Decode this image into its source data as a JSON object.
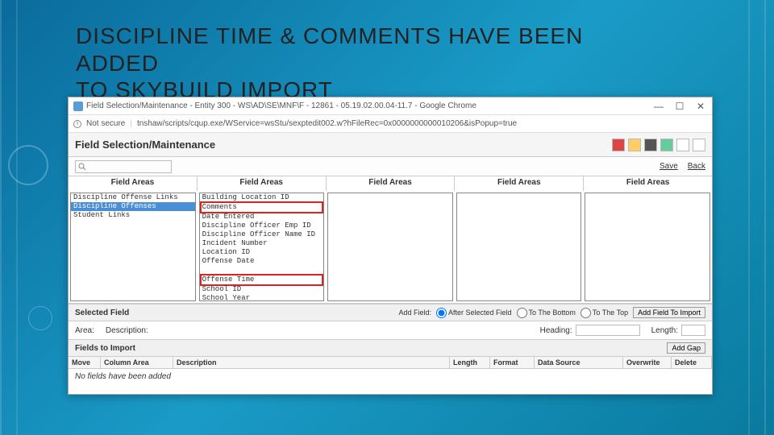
{
  "slide": {
    "title_l1": "DISCIPLINE TIME & COMMENTS HAVE BEEN",
    "title_l2": "ADDED",
    "title_l3": "TO SKYBUILD IMPORT"
  },
  "window": {
    "title": "Field Selection/Maintenance - Entity 300 - WS\\AD\\SE\\MNF\\F - 12861 - 05.19.02.00.04-11.7 - Google Chrome",
    "secure_label": "Not secure",
    "url": "tnshaw/scripts/cqup.exe/WService=wsStu/sexptedit002.w?hFileRec=0x0000000000010206&isPopup=true",
    "controls": {
      "min": "—",
      "max": "☐",
      "close": "✕"
    }
  },
  "app": {
    "title": "Field Selection/Maintenance",
    "save": "Save",
    "back": "Back",
    "col_header": "Field Areas",
    "col1_items": [
      "Discipline Offense Links",
      "Discipline Offenses",
      "Student Links"
    ],
    "col1_selected_index": 1,
    "col2_items": [
      "Building Location ID",
      "Comments",
      "Date Entered",
      "Discipline Officer Emp ID",
      "Discipline Officer Name ID",
      "Incident Number",
      "Location ID",
      "Offense Date",
      "",
      "Offense Time",
      "School ID",
      "School Year"
    ],
    "col2_highlight": [
      1,
      9
    ],
    "selected_field_label": "Selected Field",
    "add_field_label": "Add Field:",
    "radio_after": "After Selected Field",
    "radio_bottom": "To The Bottom",
    "radio_top": "To The Top",
    "add_btn": "Add Field To Import",
    "area_label": "Area:",
    "desc_label": "Description:",
    "heading_label": "Heading:",
    "length_label": "Length:",
    "fields_import_title": "Fields to Import",
    "add_gap": "Add Gap",
    "th": {
      "move": "Move",
      "area": "Column Area",
      "desc": "Description",
      "len": "Length",
      "fmt": "Format",
      "ds": "Data Source",
      "ov": "Overwrite",
      "del": "Delete"
    },
    "no_fields": "No fields have been added"
  }
}
